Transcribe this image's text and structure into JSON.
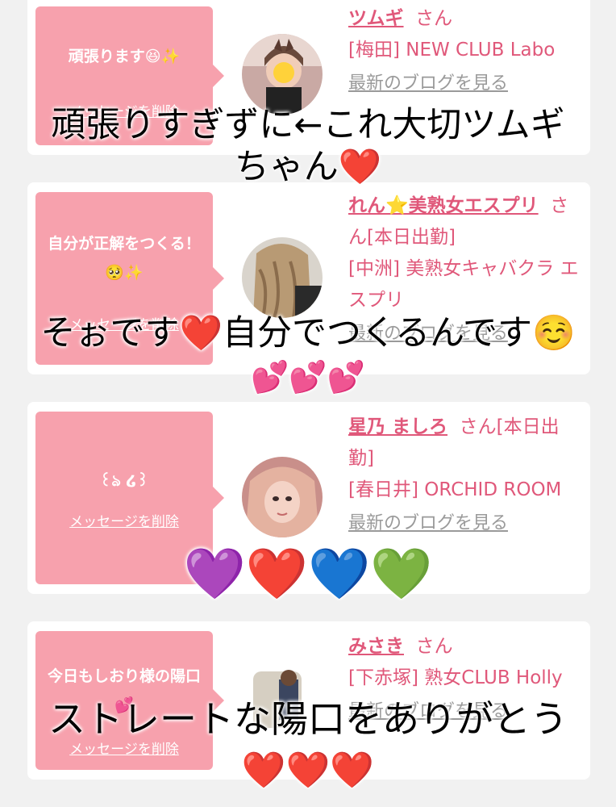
{
  "cards": [
    {
      "message": "頑張ります😆✨",
      "delete_label": "メッセージを削除",
      "name": "ツムギ",
      "honorific": "さん",
      "shop": "[梅田] NEW CLUB Labo",
      "blog_label": "最新のブログを見る"
    },
    {
      "message": "自分が正解をつくる！🥺✨",
      "delete_label": "メッセージを削除",
      "name": "れん⭐美熟女エスプリ",
      "honorific": "さん[本日出勤]",
      "shop": "[中洲] 美熟女キャバクラ エスプリ",
      "blog_label": "最新のブログを見る"
    },
    {
      "message": "꒰ঌ ໒꒱",
      "delete_label": "メッセージを削除",
      "name": "星乃 ましろ",
      "honorific": "さん[本日出勤]",
      "shop": "[春日井] ORCHID ROOM",
      "blog_label": "最新のブログを見る"
    },
    {
      "message": "今日もしおり様の陽口💕",
      "delete_label": "メッセージを削除",
      "name": "みさき",
      "honorific": "さん",
      "shop": "[下赤塚] 熟女CLUB Holly",
      "blog_label": "最新のブログを見る"
    }
  ],
  "captions": {
    "c1_line1": "頑張りすぎずに←これ大切ツムギ",
    "c1_line2": "ちゃん❤️",
    "c2_line1": "そぉです❤️自分でつくるんです☺️",
    "c2_line2": "💕💕💕",
    "c3_line1": "💜❤️💙💚",
    "c4_line1": "ストレートな陽口をありがとう",
    "c4_line2": "❤️❤️❤️"
  },
  "colors": {
    "bubble": "#f7a1ad",
    "accent": "#e0587a",
    "background": "#f1f1f1"
  }
}
